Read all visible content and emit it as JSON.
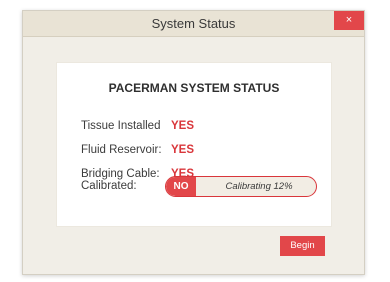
{
  "window": {
    "title": "System Status",
    "close_label": "×"
  },
  "panel": {
    "title": "PACERMAN SYSTEM STATUS",
    "rows": [
      {
        "label": "Tissue Installed",
        "value": "YES"
      },
      {
        "label": "Fluid Reservoir:",
        "value": "YES"
      },
      {
        "label": "Bridging Cable:",
        "value": "YES"
      }
    ],
    "calibrated": {
      "label": "Calibrated:",
      "value": "NO",
      "status": "Calibrating 12%",
      "progress_percent": 12
    }
  },
  "actions": {
    "begin_label": "Begin"
  },
  "colors": {
    "accent": "#e2474a",
    "window_bg": "#f1eee7",
    "titlebar_bg": "#e9e3d5"
  }
}
